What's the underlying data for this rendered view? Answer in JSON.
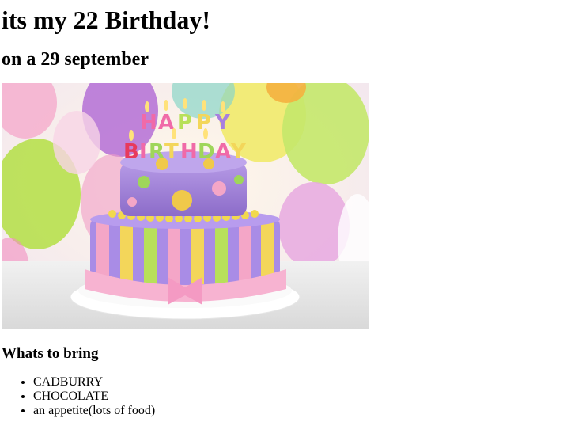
{
  "heading": "its my 22 Birthday!",
  "subheading": "on a 29 september",
  "image": {
    "icon": "birthday-cake-photo",
    "cake_text": "HAPPY BIRTHDAY"
  },
  "bring_heading": "Whats to bring",
  "bring_items": [
    "CADBURRY",
    "CHOCOLATE",
    "an appetite(lots of food)"
  ],
  "colors": {
    "background": "#ffffff",
    "text": "#000000",
    "cake_purple": "#9b7ad6",
    "cake_pink": "#f6a9c9"
  }
}
